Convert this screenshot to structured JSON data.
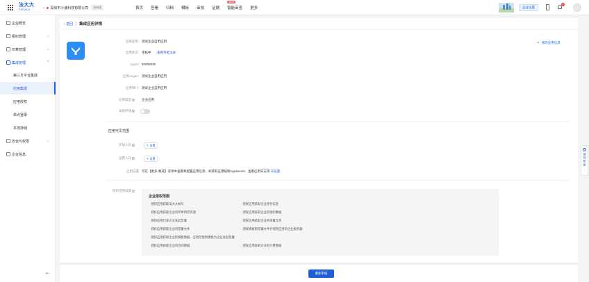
{
  "topbar": {
    "logo_text": "法大大",
    "logo_sub": "FADADA",
    "company_name": "深圳市小诸科技有限公司",
    "company_badge": "基础版",
    "nav": [
      "首页",
      "签署",
      "归档",
      "模板",
      "审批",
      "证据",
      "智能审查",
      "更多"
    ],
    "new_tag": "NEW",
    "enterprise_btn": "企业设置",
    "notif_count": "2"
  },
  "sidebar": {
    "items": [
      {
        "label": "企业概览",
        "icon": "home-icon"
      },
      {
        "label": "组织管理",
        "icon": "org-icon"
      },
      {
        "label": "印章管理",
        "icon": "seal-icon"
      },
      {
        "label": "集成管理",
        "icon": "integration-icon"
      }
    ],
    "sub_items": [
      "第三方平台集成",
      "应用集成",
      "应用授权",
      "单点登录",
      "本地存储"
    ],
    "items2": [
      {
        "label": "安全与权限",
        "icon": "security-icon"
      },
      {
        "label": "企业信息",
        "icon": "info-icon"
      }
    ],
    "selected_sub": "应用集成"
  },
  "breadcrumb": {
    "back": "返回",
    "title": "集成应用详情"
  },
  "edit_link": "修改应用信息",
  "app": {
    "name_label": "应用名称:",
    "name_value": "测试企业自用应用",
    "status_label": "应用状态:",
    "status_value": "审核中",
    "status_link": "查看审批记录",
    "appid_label": "AppId:",
    "appid_value": "80000035",
    "slogan_label": "应用slogan:",
    "slogan_value": "测试企业自用应用",
    "intro_label": "应用简介:",
    "intro_value": "测试企业自用应用",
    "type_label": "应用类型",
    "type_value": "企业应用",
    "storage_label": "本地存储"
  },
  "visible_range": {
    "title": "应用可见范围",
    "dev_label": "开放人员",
    "ops_label": "运营人员",
    "set_btn": "设置",
    "settings_label": "应用设置",
    "settings_text": "可在【更多-集成】菜单中查看和配置应用信息、如获取应用秘钥AppSecret、查看应用日志等",
    "settings_link": "去设置"
  },
  "auth_scope": {
    "label": "授权范围设置",
    "box_title": "企业授权范围",
    "left": [
      "授权应用获取法大大帐号",
      "授权应用获取企业的印章用印资源",
      "授权应用代表企业发起签署",
      "授权应用获取企业的签署文件",
      "授权应用获取企业的模板数据、应用可使用模板为企业发起签署",
      "授权应用获取企业的合同数据"
    ],
    "right": [
      "授权应用获取企业身份信息",
      "授权应用获取企业的组织数据",
      "授权应用获取企业的签署任务",
      "授权模板和签署文件存储到应用的企业服务器",
      "",
      "授权应用获取企业的计费数据"
    ]
  },
  "bottom": {
    "submit": "重新审核"
  },
  "help": {
    "text": "使用帮助"
  }
}
